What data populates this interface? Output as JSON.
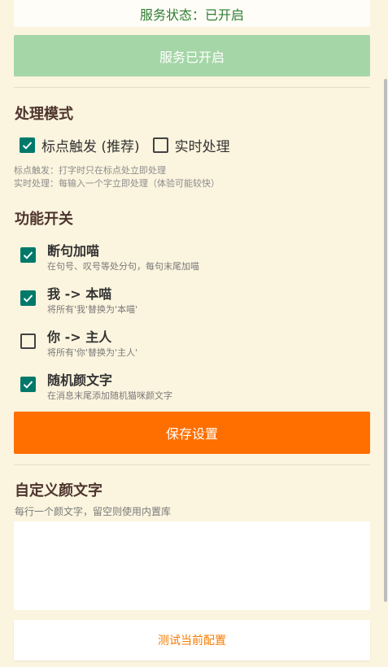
{
  "status": {
    "text": "服务状态：已开启"
  },
  "service_button": {
    "label": "服务已开启"
  },
  "processing_mode": {
    "title": "处理模式",
    "options": [
      {
        "label": "标点触发 (推荐)",
        "checked": true
      },
      {
        "label": "实时处理",
        "checked": false
      }
    ],
    "desc_lines": [
      "标点触发：打字时只在标点处立即处理",
      "实时处理：每输入一个字立即处理（体验可能较快）"
    ]
  },
  "features": {
    "title": "功能开关",
    "items": [
      {
        "label": "断句加喵",
        "desc": "在句号、叹号等处分句，每句末尾加喵",
        "checked": true
      },
      {
        "label": "我 -> 本喵",
        "desc": "将所有'我'替换为'本喵'",
        "checked": true
      },
      {
        "label": "你 -> 主人",
        "desc": "将所有'你'替换为'主人'",
        "checked": false
      },
      {
        "label": "随机颜文字",
        "desc": "在消息末尾添加随机猫咪颜文字",
        "checked": true
      }
    ]
  },
  "save_button": {
    "label": "保存设置"
  },
  "custom_kaomoji": {
    "title": "自定义颜文字",
    "hint": "每行一个颜文字，留空则使用内置库",
    "value": ""
  },
  "test_button": {
    "label": "测试当前配置"
  },
  "colors": {
    "background": "#FBF4DE",
    "status_text": "#2E7D32",
    "service_button": "#A5D6A7",
    "checkbox_checked": "#00796B",
    "save_button": "#FF6F00",
    "test_button_text": "#F57C00"
  }
}
